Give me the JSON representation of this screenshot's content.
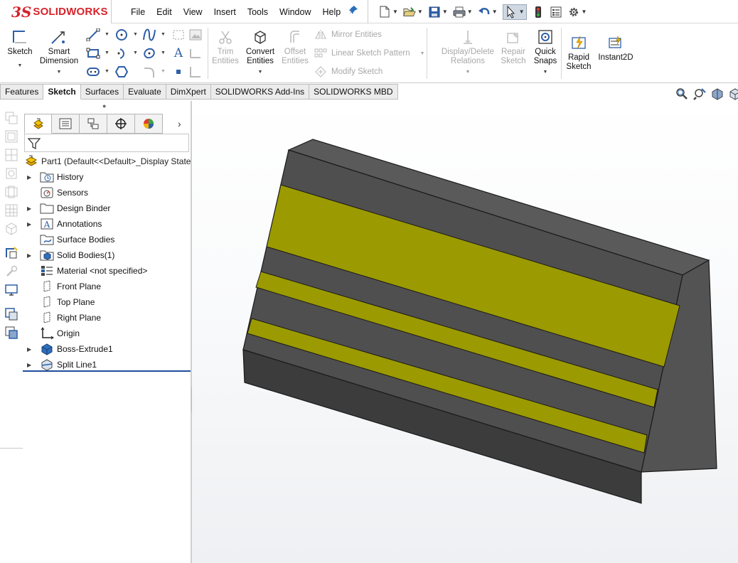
{
  "app": {
    "brand": "SOLIDWORKS",
    "brand_prefix": "3S",
    "brand_color": "#d6222a"
  },
  "menu": [
    "File",
    "Edit",
    "View",
    "Insert",
    "Tools",
    "Window",
    "Help"
  ],
  "ribbon": {
    "sketch": "Sketch",
    "smart_dimension_1": "Smart",
    "smart_dimension_2": "Dimension",
    "trim_1": "Trim",
    "trim_2": "Entities",
    "convert_1": "Convert",
    "convert_2": "Entities",
    "offset_1": "Offset",
    "offset_2": "Entities",
    "mirror": "Mirror Entities",
    "linear_pattern": "Linear Sketch Pattern",
    "modify": "Modify Sketch",
    "display_delete_1": "Display/Delete",
    "display_delete_2": "Relations",
    "repair_1": "Repair",
    "repair_2": "Sketch",
    "quick_snaps_1": "Quick",
    "quick_snaps_2": "Snaps",
    "rapid_1": "Rapid",
    "rapid_2": "Sketch",
    "instant2d": "Instant2D"
  },
  "tabs": [
    "Features",
    "Sketch",
    "Surfaces",
    "Evaluate",
    "DimXpert",
    "SOLIDWORKS Add-Ins",
    "SOLIDWORKS MBD"
  ],
  "active_tab": "Sketch",
  "tree": {
    "root_label": "Part1  (Default<<Default>_Display State",
    "items": [
      {
        "label": "History",
        "icon": "history-folder-icon",
        "expandable": true
      },
      {
        "label": "Sensors",
        "icon": "sensors-icon",
        "expandable": false
      },
      {
        "label": "Design Binder",
        "icon": "design-binder-icon",
        "expandable": true
      },
      {
        "label": "Annotations",
        "icon": "annotations-icon",
        "expandable": true
      },
      {
        "label": "Surface Bodies",
        "icon": "surface-bodies-icon",
        "expandable": false
      },
      {
        "label": "Solid Bodies(1)",
        "icon": "solid-bodies-icon",
        "expandable": true
      },
      {
        "label": "Material <not specified>",
        "icon": "material-icon",
        "expandable": false
      },
      {
        "label": "Front Plane",
        "icon": "plane-icon",
        "expandable": false
      },
      {
        "label": "Top Plane",
        "icon": "plane-icon",
        "expandable": false
      },
      {
        "label": "Right Plane",
        "icon": "plane-icon",
        "expandable": false
      },
      {
        "label": "Origin",
        "icon": "origin-icon",
        "expandable": false
      },
      {
        "label": "Boss-Extrude1",
        "icon": "boss-extrude-icon",
        "expandable": true
      },
      {
        "label": "Split Line1",
        "icon": "split-line-icon",
        "expandable": true
      }
    ]
  },
  "model": {
    "body_color": "#4d4d4d",
    "top_color": "#5a5a5a",
    "side_color": "#535353",
    "split_face_color": "#9b9a00"
  }
}
